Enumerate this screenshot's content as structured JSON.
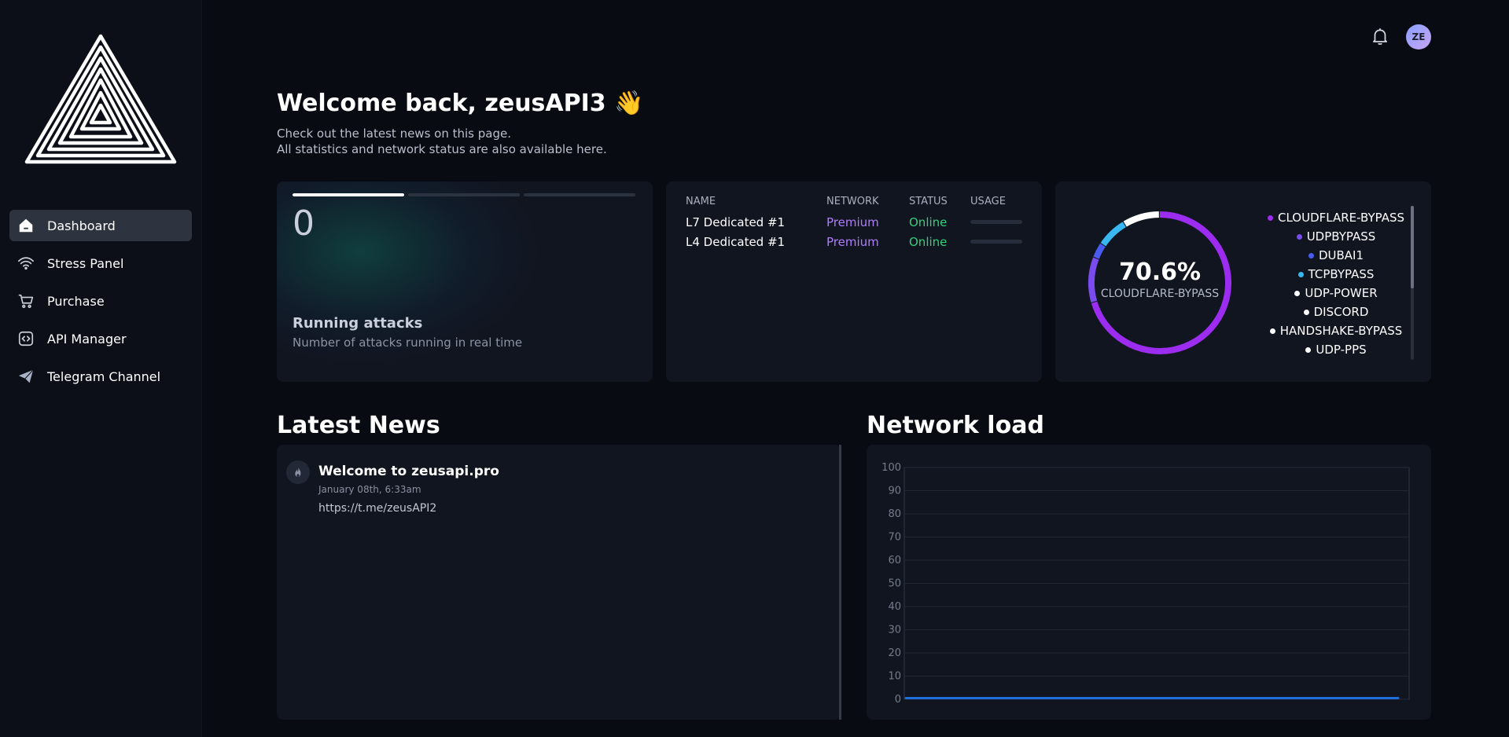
{
  "sidebar": {
    "logo_icon": "triangle-maze-logo-icon",
    "items": [
      {
        "label": "Dashboard",
        "icon": "home-icon",
        "active": true
      },
      {
        "label": "Stress Panel",
        "icon": "wifi-icon",
        "active": false
      },
      {
        "label": "Purchase",
        "icon": "cart-icon",
        "active": false
      },
      {
        "label": "API Manager",
        "icon": "code-square-icon",
        "active": false
      },
      {
        "label": "Telegram Channel",
        "icon": "send-icon",
        "active": false
      }
    ]
  },
  "header": {
    "bell_icon": "bell-icon",
    "avatar_initials": "ZE"
  },
  "welcome": {
    "title": "Welcome back, zeusAPI3 👋",
    "line1": "Check out the latest news on this page.",
    "line2": "All statistics and network status are also available here."
  },
  "running_card": {
    "count": "0",
    "title": "Running attacks",
    "subtitle": "Number of attacks running in real time",
    "progress": [
      1.0,
      0.0,
      0.0
    ]
  },
  "servers": {
    "headers": [
      "NAME",
      "NETWORK",
      "STATUS",
      "USAGE"
    ],
    "rows": [
      {
        "name": "L7 Dedicated #1",
        "network": "Premium",
        "status": "Online",
        "usage": 0
      },
      {
        "name": "L4 Dedicated #1",
        "network": "Premium",
        "status": "Online",
        "usage": 0
      }
    ]
  },
  "methods": {
    "percent": "70.6%",
    "label": "CLOUDFLARE-BYPASS",
    "segments": [
      {
        "name": "CLOUDFLARE-BYPASS",
        "share": 70.6,
        "color": "#9b2cf0"
      },
      {
        "name": "UDPBYPASS",
        "share": 10.4,
        "color": "#7a4cf0"
      },
      {
        "name": "DUBAI1",
        "share": 3.5,
        "color": "#4a5cf0"
      },
      {
        "name": "TCPBYPASS",
        "share": 7.0,
        "color": "#38b8f0"
      },
      {
        "name": "UDP-POWER",
        "share": 8.5,
        "color": "#ffffff"
      }
    ],
    "legend": [
      {
        "name": "CLOUDFLARE-BYPASS",
        "color": "#9b2cf0"
      },
      {
        "name": "UDPBYPASS",
        "color": "#7a4cf0"
      },
      {
        "name": "DUBAI1",
        "color": "#4a5cf0"
      },
      {
        "name": "TCPBYPASS",
        "color": "#38b8f0"
      },
      {
        "name": "UDP-POWER",
        "color": "#ffffff"
      },
      {
        "name": "DISCORD",
        "color": "#ffffff"
      },
      {
        "name": "HANDSHAKE-BYPASS",
        "color": "#ffffff"
      },
      {
        "name": "UDP-PPS",
        "color": "#ffffff"
      }
    ]
  },
  "news": {
    "section_title": "Latest News",
    "icon": "flame-icon",
    "items": [
      {
        "title": "Welcome to zeusapi.pro",
        "date": "January 08th, 6:33am",
        "body": "https://t.me/zeusAPI2"
      }
    ]
  },
  "network": {
    "section_title": "Network load"
  },
  "chart_data": {
    "type": "area",
    "title": "",
    "xlabel": "",
    "ylabel": "",
    "ylim": [
      0,
      100
    ],
    "yticks": [
      0,
      10,
      20,
      30,
      40,
      50,
      60,
      70,
      80,
      90,
      100
    ],
    "series": [
      {
        "values": [
          0,
          0,
          0,
          0,
          0,
          0,
          0,
          0,
          0,
          0,
          0,
          0
        ],
        "color": "#1e6fd9"
      }
    ]
  },
  "colors": {
    "background": "#090b12",
    "card": "#111520",
    "accent_purple": "#b07cff",
    "status_green": "#2fd27a"
  }
}
